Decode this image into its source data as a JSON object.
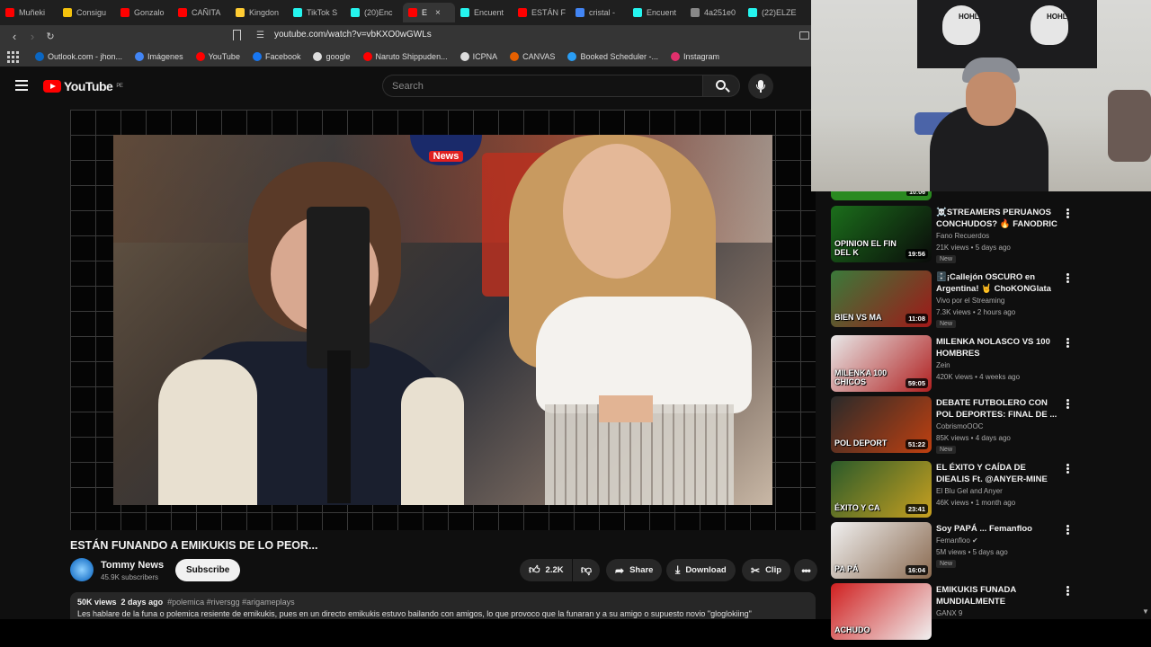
{
  "browser": {
    "tabs": [
      {
        "label": "Muñeki",
        "color": "#ff0000"
      },
      {
        "label": "Consigu",
        "color": "#f4c20d"
      },
      {
        "label": "Gonzalo",
        "color": "#ff0000"
      },
      {
        "label": "CAÑITA",
        "color": "#ff0000"
      },
      {
        "label": "Kingdon",
        "color": "#ffcc33"
      },
      {
        "label": "TikTok S",
        "color": "#25f4ee"
      },
      {
        "label": "(20)Enc",
        "color": "#25f4ee"
      },
      {
        "label": "E",
        "color": "#ff0000",
        "active": true
      },
      {
        "label": "Encuent",
        "color": "#25f4ee"
      },
      {
        "label": "ESTÁN F",
        "color": "#ff0000"
      },
      {
        "label": "cristal -",
        "color": "#4285f4"
      },
      {
        "label": "Encuent",
        "color": "#25f4ee"
      },
      {
        "label": "4a251e0",
        "color": "#888888"
      },
      {
        "label": "(22)ELZE",
        "color": "#25f4ee"
      }
    ],
    "url": "youtube.com/watch?v=vbKXO0wGWLs",
    "bookmarks": [
      {
        "label": "Outlook.com - jhon...",
        "color": "#0a66c2"
      },
      {
        "label": "Imágenes",
        "color": "#4285f4"
      },
      {
        "label": "YouTube",
        "color": "#ff0000"
      },
      {
        "label": "Facebook",
        "color": "#1877f2"
      },
      {
        "label": "google",
        "color": "#dddddd"
      },
      {
        "label": "Naruto Shippuden...",
        "color": "#ff0000"
      },
      {
        "label": "ICPNA",
        "color": "#dddddd"
      },
      {
        "label": "CANVAS",
        "color": "#e66000"
      },
      {
        "label": "Booked Scheduler -...",
        "color": "#2a9df4"
      },
      {
        "label": "Instagram",
        "color": "#e1306c"
      }
    ]
  },
  "youtube": {
    "logo_text": "YouTube",
    "region": "PE",
    "search_placeholder": "Search"
  },
  "video": {
    "title": "ESTÁN FUNANDO A EMIKUKIS DE LO PEOR...",
    "news_logo": "News",
    "channel": "Tommy News",
    "subscribers": "45.9K subscribers",
    "subscribe_label": "Subscribe",
    "likes": "2.2K",
    "share_label": "Share",
    "download_label": "Download",
    "clip_label": "Clip",
    "views": "50K views",
    "date": "2 days ago",
    "tags": "#polemica #riversgg #arigameplays",
    "description": "Les hablare de la funa o polemica resiente de emikukis, pues en un directo emikukis estuvo bailando con amigos, lo que provoco que la funaran y a su amigo o supuesto novio \"gloglokiing\""
  },
  "recommendations": [
    {
      "title": "☠️STREAMERS PERUANOS CONCHUDOS? 🔥 FANODRIC ...",
      "channel": "Fano Recuerdos",
      "meta": "21K views • 5 days ago",
      "new": true,
      "duration": "19:56",
      "overlay": "OPINION EL FIN DEL K",
      "c1": "#1b6e1b",
      "c2": "#0a0a0a"
    },
    {
      "title": "🗄️¡Callejón OSCURO en Argentina! 🤘 ChoKONGlata ...",
      "channel": "Vivo por el Streaming",
      "meta": "7.3K views • 2 hours ago",
      "new": true,
      "duration": "11:08",
      "overlay": "BIEN VS MA",
      "c1": "#3a7a3a",
      "c2": "#a01818"
    },
    {
      "title": "MILENKA NOLASCO VS 100 HOMBRES",
      "channel": "Zein",
      "meta": "420K views • 4 weeks ago",
      "new": false,
      "duration": "59:05",
      "overlay": "MILENKA 100 CHICOS",
      "c1": "#e8e8e8",
      "c2": "#b02020"
    },
    {
      "title": "DEBATE FUTBOLERO CON POL DEPORTES: FINAL DE ...",
      "channel": "CobrismoOOC",
      "meta": "85K views • 4 days ago",
      "new": true,
      "duration": "51:22",
      "overlay": "POL DEPORT",
      "c1": "#2a2a2a",
      "c2": "#c04010"
    },
    {
      "title": "EL ÉXITO Y CAÍDA DE DIEALIS Ft. @ANYER-MINE",
      "channel": "El Blu Gel and Anyer",
      "meta": "46K views • 1 month ago",
      "new": false,
      "duration": "23:41",
      "overlay": "ÉXITO Y CA",
      "c1": "#2a5a2a",
      "c2": "#c8a020"
    },
    {
      "title": "Soy PAPÁ ... Femanfloo",
      "channel": "Femanfloo ✔",
      "meta": "5M views • 5 days ago",
      "new": true,
      "duration": "16:04",
      "overlay": "PA PÁ",
      "c1": "#f0f0f0",
      "c2": "#8a6a50"
    },
    {
      "title": "EMIKUKIS FUNADA MUNDIALMENTE",
      "channel": "GANX 9",
      "meta": "",
      "new": false,
      "duration": "",
      "overlay": "ACHUDO",
      "c1": "#d02020",
      "c2": "#f0f0f0"
    }
  ],
  "first_partial_duration": "10:06",
  "webcam": {
    "banner_text_1": "HOHL",
    "banner_text_2": "HOHL"
  },
  "labels": {
    "new": "New"
  }
}
